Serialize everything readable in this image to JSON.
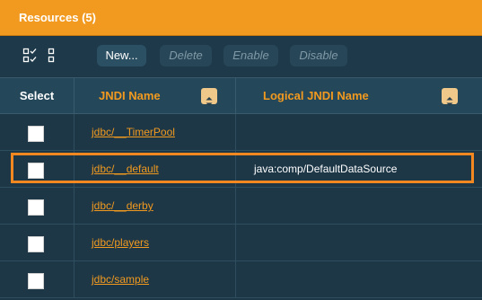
{
  "panel": {
    "title": "Resources (5)"
  },
  "toolbar": {
    "select_all_icon": "select-all-icon",
    "deselect_all_icon": "deselect-all-icon",
    "new_label": "New...",
    "delete_label": "Delete",
    "enable_label": "Enable",
    "disable_label": "Disable"
  },
  "table": {
    "headers": {
      "select": "Select",
      "jndi_name": "JNDI Name",
      "logical_jndi_name": "Logical JNDI Name"
    },
    "rows": [
      {
        "jndi_name": "jdbc/__TimerPool",
        "logical_jndi_name": ""
      },
      {
        "jndi_name": "jdbc/__default",
        "logical_jndi_name": "java:comp/DefaultDataSource"
      },
      {
        "jndi_name": "jdbc/__derby",
        "logical_jndi_name": ""
      },
      {
        "jndi_name": "jdbc/players",
        "logical_jndi_name": ""
      },
      {
        "jndi_name": "jdbc/sample",
        "logical_jndi_name": ""
      }
    ]
  },
  "colors": {
    "accent": "#f29a1f",
    "background": "#1d3747",
    "highlight": "#f2881f"
  }
}
